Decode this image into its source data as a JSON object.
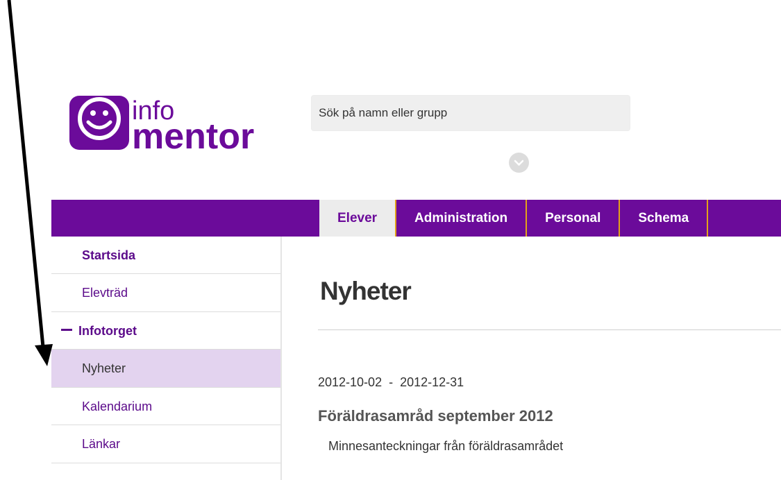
{
  "header": {
    "logo": {
      "word_top": "info",
      "word_bottom": "mentor",
      "brand_color": "#6b0b9a"
    },
    "search": {
      "placeholder": "Sök på namn eller grupp"
    },
    "toggle_icon": "chevron-down-icon"
  },
  "nav": {
    "tabs": [
      {
        "label": "Elever",
        "active": true
      },
      {
        "label": "Administration",
        "active": false
      },
      {
        "label": "Personal",
        "active": false
      },
      {
        "label": "Schema",
        "active": false
      }
    ]
  },
  "sidebar": {
    "items": [
      {
        "label": "Startsida"
      },
      {
        "label": "Elevträd"
      },
      {
        "label": "Infotorget",
        "expanded": true
      },
      {
        "label": "Nyheter",
        "active": true
      },
      {
        "label": "Kalendarium"
      },
      {
        "label": "Länkar"
      }
    ]
  },
  "main": {
    "title": "Nyheter",
    "news": [
      {
        "date_range": "2012-10-02  -  2012-12-31",
        "title": "Föräldrasamråd september 2012",
        "description": "Minnesanteckningar från föräldrasamrådet"
      }
    ]
  },
  "colors": {
    "nav_bg": "#6b0b9a",
    "tab_divider": "#e3a21a",
    "active_item_bg": "#e3d3ef",
    "link_color": "#5b0a8a"
  }
}
